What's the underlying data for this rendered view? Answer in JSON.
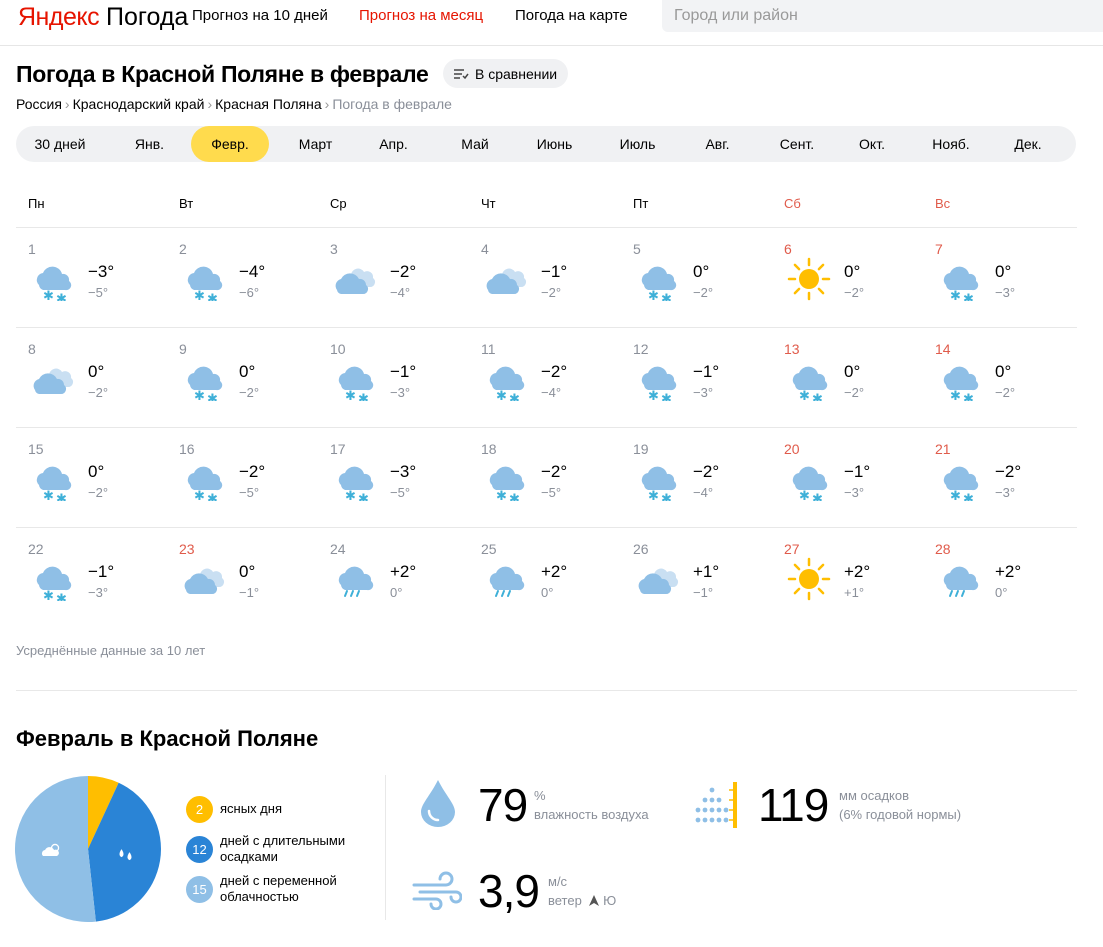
{
  "header": {
    "logo_brand": "Яндекс",
    "logo_product": "Погода",
    "nav": [
      {
        "label": "Прогноз на 10 дней",
        "active": false
      },
      {
        "label": "Прогноз на месяц",
        "active": true
      },
      {
        "label": "Погода на карте",
        "active": false
      }
    ],
    "search_placeholder": "Город или район"
  },
  "page": {
    "title": "Погода в Красной Поляне в феврале",
    "compare_label": "В сравнении",
    "breadcrumbs": [
      "Россия",
      "Краснодарский край",
      "Красная Поляна"
    ],
    "breadcrumb_current": "Погода в феврале"
  },
  "month_tabs": [
    {
      "label": "30 дней",
      "active": false
    },
    {
      "label": "Янв.",
      "active": false
    },
    {
      "label": "Февр.",
      "active": true
    },
    {
      "label": "Март",
      "active": false
    },
    {
      "label": "Апр.",
      "active": false
    },
    {
      "label": "Май",
      "active": false
    },
    {
      "label": "Июнь",
      "active": false
    },
    {
      "label": "Июль",
      "active": false
    },
    {
      "label": "Авг.",
      "active": false
    },
    {
      "label": "Сент.",
      "active": false
    },
    {
      "label": "Окт.",
      "active": false
    },
    {
      "label": "Нояб.",
      "active": false
    },
    {
      "label": "Дек.",
      "active": false
    }
  ],
  "weekdays": [
    {
      "label": "Пн",
      "weekend": false
    },
    {
      "label": "Вт",
      "weekend": false
    },
    {
      "label": "Ср",
      "weekend": false
    },
    {
      "label": "Чт",
      "weekend": false
    },
    {
      "label": "Пт",
      "weekend": false
    },
    {
      "label": "Сб",
      "weekend": true
    },
    {
      "label": "Вс",
      "weekend": true
    }
  ],
  "days": [
    {
      "day": "1",
      "hi": "−3°",
      "lo": "−5°",
      "icon": "cloud-snow-icon",
      "red": false
    },
    {
      "day": "2",
      "hi": "−4°",
      "lo": "−6°",
      "icon": "cloud-snow-icon",
      "red": false
    },
    {
      "day": "3",
      "hi": "−2°",
      "lo": "−4°",
      "icon": "overcast-icon",
      "red": false
    },
    {
      "day": "4",
      "hi": "−1°",
      "lo": "−2°",
      "icon": "overcast-icon",
      "red": false
    },
    {
      "day": "5",
      "hi": "0°",
      "lo": "−2°",
      "icon": "cloud-snow-icon",
      "red": false
    },
    {
      "day": "6",
      "hi": "0°",
      "lo": "−2°",
      "icon": "sun-icon",
      "red": true
    },
    {
      "day": "7",
      "hi": "0°",
      "lo": "−3°",
      "icon": "cloud-snow-icon",
      "red": true
    },
    {
      "day": "8",
      "hi": "0°",
      "lo": "−2°",
      "icon": "overcast-icon",
      "red": false
    },
    {
      "day": "9",
      "hi": "0°",
      "lo": "−2°",
      "icon": "cloud-snow-icon",
      "red": false
    },
    {
      "day": "10",
      "hi": "−1°",
      "lo": "−3°",
      "icon": "cloud-snow-icon",
      "red": false
    },
    {
      "day": "11",
      "hi": "−2°",
      "lo": "−4°",
      "icon": "cloud-snow-icon",
      "red": false
    },
    {
      "day": "12",
      "hi": "−1°",
      "lo": "−3°",
      "icon": "cloud-snow-icon",
      "red": false
    },
    {
      "day": "13",
      "hi": "0°",
      "lo": "−2°",
      "icon": "cloud-snow-icon",
      "red": true
    },
    {
      "day": "14",
      "hi": "0°",
      "lo": "−2°",
      "icon": "cloud-snow-icon",
      "red": true
    },
    {
      "day": "15",
      "hi": "0°",
      "lo": "−2°",
      "icon": "cloud-snow-icon",
      "red": false
    },
    {
      "day": "16",
      "hi": "−2°",
      "lo": "−5°",
      "icon": "cloud-snow-icon",
      "red": false
    },
    {
      "day": "17",
      "hi": "−3°",
      "lo": "−5°",
      "icon": "cloud-snow-icon",
      "red": false
    },
    {
      "day": "18",
      "hi": "−2°",
      "lo": "−5°",
      "icon": "cloud-snow-icon",
      "red": false
    },
    {
      "day": "19",
      "hi": "−2°",
      "lo": "−4°",
      "icon": "cloud-snow-icon",
      "red": false
    },
    {
      "day": "20",
      "hi": "−1°",
      "lo": "−3°",
      "icon": "cloud-snow-icon",
      "red": true
    },
    {
      "day": "21",
      "hi": "−2°",
      "lo": "−3°",
      "icon": "cloud-snow-icon",
      "red": true
    },
    {
      "day": "22",
      "hi": "−1°",
      "lo": "−3°",
      "icon": "cloud-snow-icon",
      "red": false
    },
    {
      "day": "23",
      "hi": "0°",
      "lo": "−1°",
      "icon": "overcast-icon",
      "red": true
    },
    {
      "day": "24",
      "hi": "+2°",
      "lo": "0°",
      "icon": "cloud-rain-icon",
      "red": false
    },
    {
      "day": "25",
      "hi": "+2°",
      "lo": "0°",
      "icon": "cloud-rain-icon",
      "red": false
    },
    {
      "day": "26",
      "hi": "+1°",
      "lo": "−1°",
      "icon": "overcast-icon",
      "red": false
    },
    {
      "day": "27",
      "hi": "+2°",
      "lo": "+1°",
      "icon": "sun-icon",
      "red": true
    },
    {
      "day": "28",
      "hi": "+2°",
      "lo": "0°",
      "icon": "cloud-rain-icon",
      "red": true
    }
  ],
  "avg_note": "Усреднённые данные за 10 лет",
  "summary": {
    "title": "Февраль в Красной Поляне",
    "legend": [
      {
        "count": "2",
        "text": "ясных дня",
        "color": "#ffbe00"
      },
      {
        "count": "12",
        "text": "дней с длительными осадками",
        "color": "#2a84d6"
      },
      {
        "count": "15",
        "text": "дней с переменной облачностью",
        "color": "#8fbfe6"
      }
    ],
    "humidity": {
      "value": "79",
      "unit": "%",
      "label": "влажность воздуха"
    },
    "precip": {
      "value": "119",
      "unit": "мм осадков",
      "label": "(6% годовой нормы)"
    },
    "wind": {
      "value": "3,9",
      "unit": "м/с",
      "label": "ветер",
      "dir": "Ю"
    }
  },
  "colors": {
    "accent": "#ffdb4d",
    "red": "#e61400",
    "weekend": "#e05b4b",
    "cloud": "#8fbfe6",
    "snow": "#3fb0d8",
    "sun": "#ffbe00"
  }
}
